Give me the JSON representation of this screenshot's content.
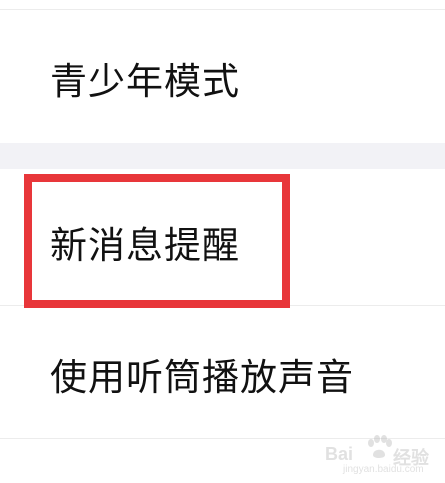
{
  "settings": {
    "items": [
      {
        "label": "青少年模式"
      },
      {
        "label": "新消息提醒"
      },
      {
        "label": "使用听筒播放声音"
      }
    ]
  },
  "watermark": {
    "brand": "Bai",
    "name": "经验",
    "domain": "jingyan.baidu.com"
  },
  "colors": {
    "highlight": "#e8363a",
    "separator_band": "#f2f2f6",
    "text": "#111111"
  }
}
